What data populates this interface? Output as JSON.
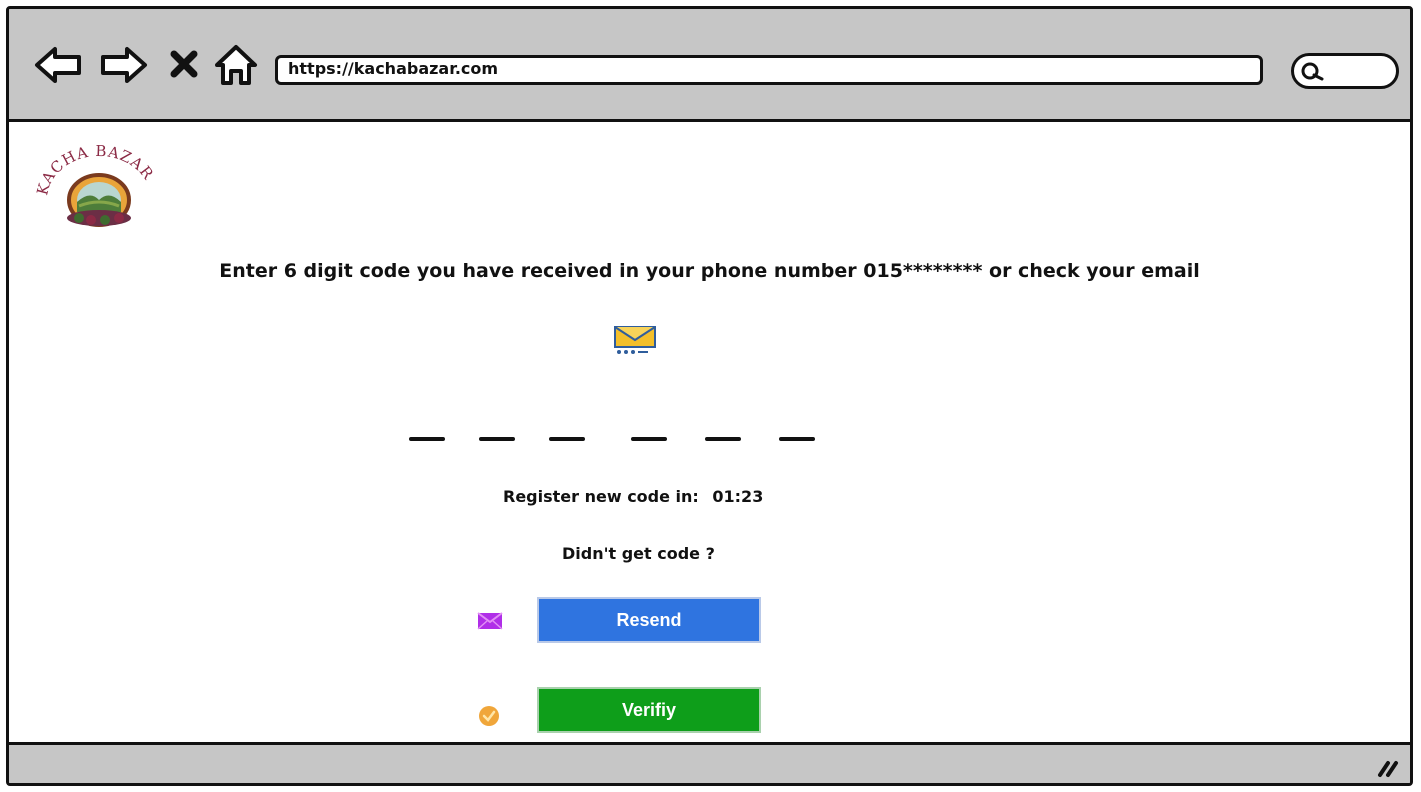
{
  "browser": {
    "url": "https://kachabazar.com",
    "icons": [
      "back-arrow-icon",
      "forward-arrow-icon",
      "close-icon",
      "home-icon",
      "search-icon",
      "resize-grip-icon"
    ]
  },
  "logo": {
    "text": "KACHA BAZAR"
  },
  "verification": {
    "instruction": "Enter 6 digit code you have received in your phone number 015******** or check your email",
    "code_slots": [
      "",
      "",
      "",
      "",
      "",
      ""
    ],
    "countdown_label": "Register new code in:",
    "countdown_value": "01:23",
    "no_code_text": "Didn't get code ?",
    "resend_label": "Resend",
    "verify_label": "Verifiy"
  },
  "colors": {
    "resend": "#2f74e0",
    "verify": "#0e9e1a",
    "chrome": "#c6c6c6"
  }
}
